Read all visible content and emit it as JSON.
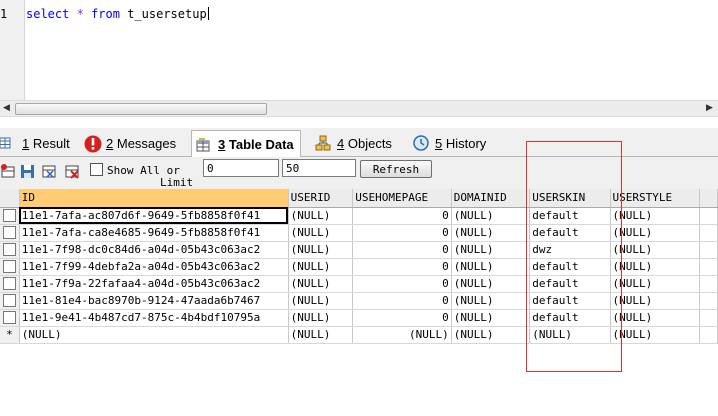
{
  "editor": {
    "line_number": "1",
    "query": {
      "select": "select",
      "star": "*",
      "from": "from",
      "table": "t_usersetup"
    }
  },
  "tabs": [
    {
      "num": "1",
      "label": "Result",
      "icon": "grid-icon"
    },
    {
      "num": "2",
      "label": "Messages",
      "icon": "info-icon"
    },
    {
      "num": "3",
      "label": "Table Data",
      "icon": "table-data-icon",
      "active": true
    },
    {
      "num": "4",
      "label": "Objects",
      "icon": "objects-icon"
    },
    {
      "num": "5",
      "label": "History",
      "icon": "history-icon"
    }
  ],
  "toolbar": {
    "show_all_label": "Show All",
    "or_label": "or",
    "limit_label": "Limit",
    "limit_from": "0",
    "limit_count": "50",
    "refresh_label": "Refresh"
  },
  "grid": {
    "columns": [
      "ID",
      "USERID",
      "USEHOMEPAGE",
      "DOMAINID",
      "USERSKIN",
      "USERSTYLE"
    ],
    "rows": [
      [
        "11e1-7afa-ac807d6f-9649-5fb8858f0f41",
        "(NULL)",
        "0",
        "(NULL)",
        "default",
        "(NULL)"
      ],
      [
        "11e1-7afa-ca8e4685-9649-5fb8858f0f41",
        "(NULL)",
        "0",
        "(NULL)",
        "default",
        "(NULL)"
      ],
      [
        "11e1-7f98-dc0c84d6-a04d-05b43c063ac2",
        "(NULL)",
        "0",
        "(NULL)",
        "dwz",
        "(NULL)"
      ],
      [
        "11e1-7f99-4debfa2a-a04d-05b43c063ac2",
        "(NULL)",
        "0",
        "(NULL)",
        "default",
        "(NULL)"
      ],
      [
        "11e1-7f9a-22fafaa4-a04d-05b43c063ac2",
        "(NULL)",
        "0",
        "(NULL)",
        "default",
        "(NULL)"
      ],
      [
        "11e1-81e4-bac8970b-9124-47aada6b7467",
        "(NULL)",
        "0",
        "(NULL)",
        "default",
        "(NULL)"
      ],
      [
        "11e1-9e41-4b487cd7-875c-4b4bdf10795a",
        "(NULL)",
        "0",
        "(NULL)",
        "default",
        "(NULL)"
      ]
    ],
    "new_row_marker": "*",
    "new_row": [
      "(NULL)",
      "(NULL)",
      "(NULL)",
      "(NULL)",
      "(NULL)",
      "(NULL)"
    ]
  },
  "colors": {
    "highlight_header": "#ffcc73",
    "annotation_box": "#e03030"
  }
}
